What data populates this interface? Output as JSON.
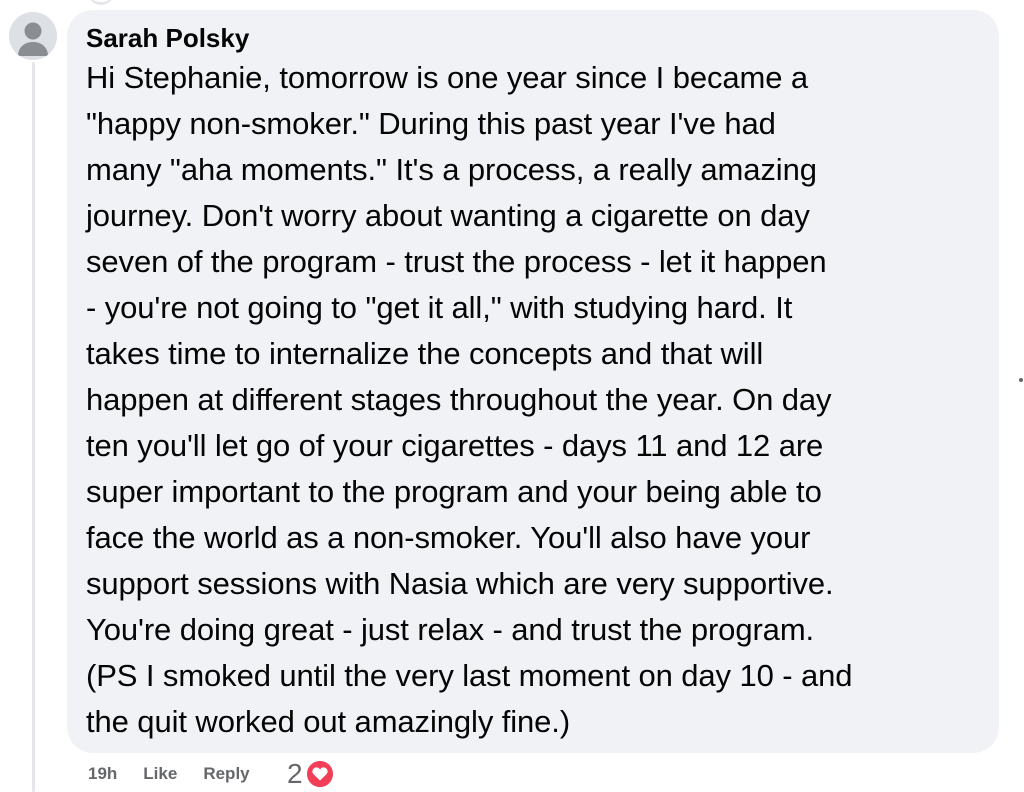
{
  "comment": {
    "author": "Sarah Polsky",
    "lines": [
      "Hi Stephanie, tomorrow is one year since I became a",
      "\"happy non-smoker.\" During this past year I've had",
      "many \"aha moments.\" It's a process, a really amazing",
      "journey. Don't worry about wanting a cigarette on day",
      "seven of the program - trust the process - let it happen",
      "- you're not going to \"get it all,\" with studying hard. It",
      "takes time to internalize the concepts and that will",
      "happen at different stages throughout the year. On day",
      "ten you'll let go of your cigarettes - days 11 and 12 are",
      "super important to the program and your being able to",
      "face the world as a non-smoker. You'll also have your",
      "support sessions with Nasia which are very supportive.",
      "You're doing great - just relax - and trust the program.",
      "(PS I smoked until the very last moment on day 10 - and",
      "the quit worked out amazingly fine.)"
    ]
  },
  "actions": {
    "time": "19h",
    "like_label": "Like",
    "reply_label": "Reply"
  },
  "reactions": {
    "count": "2",
    "icon": "heart-icon",
    "color": "#f33e58"
  },
  "colors": {
    "bubble": "#f0f2f5",
    "meta_text": "#65676b",
    "body_text": "#050505"
  }
}
